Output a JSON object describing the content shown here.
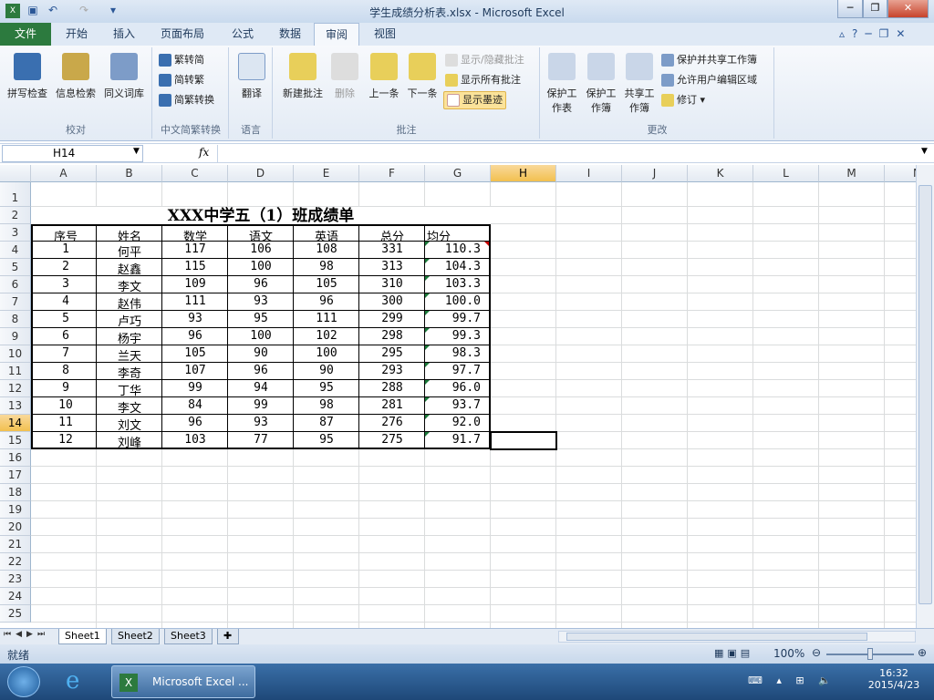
{
  "window": {
    "title": "学生成绩分析表.xlsx - Microsoft Excel"
  },
  "tabs": [
    "文件",
    "开始",
    "插入",
    "页面布局",
    "公式",
    "数据",
    "审阅",
    "视图"
  ],
  "active_tab": "审阅",
  "ribbon": {
    "proof": {
      "label": "校对",
      "buttons": [
        "拼写检查",
        "信息检索",
        "同义词库"
      ]
    },
    "chinese": {
      "label": "中文简繁转换",
      "buttons": [
        "繁转简",
        "简转繁",
        "简繁转换"
      ]
    },
    "language": {
      "label": "语言",
      "buttons": [
        "翻译"
      ]
    },
    "comments": {
      "label": "批注",
      "buttons": [
        "新建批注",
        "删除",
        "上一条",
        "下一条"
      ],
      "small": [
        "显示/隐藏批注",
        "显示所有批注",
        "显示墨迹"
      ]
    },
    "changes": {
      "label": "更改",
      "buttons": [
        "保护工作表",
        "保护工作簿",
        "共享工作簿"
      ],
      "small": [
        "保护并共享工作簿",
        "允许用户编辑区域",
        "修订"
      ]
    }
  },
  "formula_bar": {
    "name_box": "H14",
    "fx": "fx",
    "value": ""
  },
  "columns": [
    "A",
    "B",
    "C",
    "D",
    "E",
    "F",
    "G",
    "H",
    "I",
    "J",
    "K",
    "L",
    "M",
    "N"
  ],
  "rows": [
    "1",
    "2",
    "3",
    "4",
    "5",
    "6",
    "7",
    "8",
    "9",
    "10",
    "11",
    "12",
    "13",
    "14",
    "15",
    "16",
    "17",
    "18",
    "19",
    "20",
    "21",
    "22",
    "23",
    "24",
    "25"
  ],
  "selected_cell": "H14",
  "sheet": {
    "title": "XXX中学五（1）班成绩单",
    "headers": [
      "序号",
      "姓名",
      "数学",
      "语文",
      "英语",
      "总分",
      "均分"
    ],
    "rows": [
      [
        "1",
        "何平",
        "117",
        "106",
        "108",
        "331",
        "110.3"
      ],
      [
        "2",
        "赵鑫",
        "115",
        "100",
        "98",
        "313",
        "104.3"
      ],
      [
        "3",
        "李文",
        "109",
        "96",
        "105",
        "310",
        "103.3"
      ],
      [
        "4",
        "赵伟",
        "111",
        "93",
        "96",
        "300",
        "100.0"
      ],
      [
        "5",
        "卢巧",
        "93",
        "95",
        "111",
        "299",
        "99.7"
      ],
      [
        "6",
        "杨宇",
        "96",
        "100",
        "102",
        "298",
        "99.3"
      ],
      [
        "7",
        "兰天",
        "105",
        "90",
        "100",
        "295",
        "98.3"
      ],
      [
        "8",
        "李奇",
        "107",
        "96",
        "90",
        "293",
        "97.7"
      ],
      [
        "9",
        "丁华",
        "99",
        "94",
        "95",
        "288",
        "96.0"
      ],
      [
        "10",
        "李文",
        "84",
        "99",
        "98",
        "281",
        "93.7"
      ],
      [
        "11",
        "刘文",
        "96",
        "93",
        "87",
        "276",
        "92.0"
      ],
      [
        "12",
        "刘峰",
        "103",
        "77",
        "95",
        "275",
        "91.7"
      ]
    ]
  },
  "sheet_tabs": [
    "Sheet1",
    "Sheet2",
    "Sheet3"
  ],
  "active_sheet": "Sheet1",
  "status": {
    "mode": "就绪",
    "zoom": "100%"
  },
  "taskbar": {
    "app": "Microsoft Excel ...",
    "time": "16:32",
    "date": "2015/4/23"
  },
  "colors": {
    "file_tab": "#2c7a3e",
    "selection": "#f2c04f",
    "title_bar": "#c9daee"
  }
}
